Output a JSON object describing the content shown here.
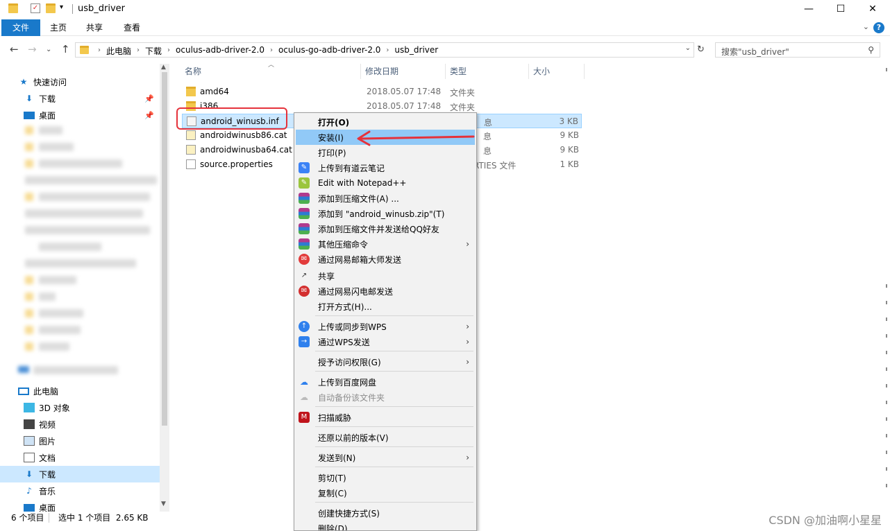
{
  "window": {
    "title": "usb_driver"
  },
  "ribbon": {
    "tabs": [
      "文件",
      "主页",
      "共享",
      "查看"
    ],
    "help": "?"
  },
  "address": {
    "crumbs": [
      "此电脑",
      "下载",
      "oculus-adb-driver-2.0",
      "oculus-go-adb-driver-2.0",
      "usb_driver"
    ],
    "search_placeholder": "搜索\"usb_driver\""
  },
  "sidebar": {
    "quick_access": "快速访问",
    "pinned": [
      "下载",
      "桌面"
    ],
    "this_pc": "此电脑",
    "pc_items": [
      "3D 对象",
      "视频",
      "图片",
      "文档",
      "下载",
      "音乐",
      "桌面"
    ]
  },
  "columns": {
    "name": "名称",
    "date": "修改日期",
    "type": "类型",
    "size": "大小"
  },
  "files": [
    {
      "name": "amd64",
      "date": "2018.05.07 17:48",
      "type": "文件夹",
      "size": "",
      "icon": "folder"
    },
    {
      "name": "i386",
      "date": "2018.05.07 17:48",
      "type": "文件夹",
      "size": "",
      "icon": "folder"
    },
    {
      "name": "android_winusb.inf",
      "date": "",
      "type": "息",
      "size": "3 KB",
      "icon": "inf-file"
    },
    {
      "name": "androidwinusb86.cat",
      "date": "",
      "type": "息",
      "size": "9 KB",
      "icon": "cat-file"
    },
    {
      "name": "androidwinusba64.cat",
      "date": "",
      "type": "息",
      "size": "9 KB",
      "icon": "cat-file"
    },
    {
      "name": "source.properties",
      "date": "",
      "type": "RTIES 文件",
      "size": "1 KB",
      "icon": "doc-file"
    }
  ],
  "context_menu": [
    {
      "label": "打开(O)",
      "bold": true
    },
    {
      "label": "安装(I)",
      "hover": true
    },
    {
      "label": "打印(P)"
    },
    {
      "label": "上传到有道云笔记",
      "icon": "youdao-icon"
    },
    {
      "label": "Edit with Notepad++",
      "icon": "notepad-icon"
    },
    {
      "label": "添加到压缩文件(A) ...",
      "icon": "winrar-icon"
    },
    {
      "label": "添加到 \"android_winusb.zip\"(T)",
      "icon": "winrar-icon"
    },
    {
      "label": "添加到压缩文件并发送给QQ好友",
      "icon": "winrar-icon"
    },
    {
      "label": "其他压缩命令",
      "icon": "winrar-icon",
      "submenu": true
    },
    {
      "label": "通过网易邮箱大师发送",
      "icon": "netease-mail-icon"
    },
    {
      "label": "共享",
      "icon": "share-icon"
    },
    {
      "label": "通过网易闪电邮发送",
      "icon": "netease-flash-icon"
    },
    {
      "label": "打开方式(H)..."
    },
    {
      "label": "上传或同步到WPS",
      "icon": "wps-cloud-icon",
      "submenu": true
    },
    {
      "label": "通过WPS发送",
      "icon": "wps-send-icon",
      "submenu": true
    },
    {
      "label": "授予访问权限(G)",
      "submenu": true
    },
    {
      "label": "上传到百度网盘",
      "icon": "baidu-icon"
    },
    {
      "label": "自动备份该文件夹",
      "icon": "baidu-icon",
      "disabled": true
    },
    {
      "label": "扫描威胁",
      "icon": "mcafee-icon"
    },
    {
      "label": "还原以前的版本(V)"
    },
    {
      "label": "发送到(N)",
      "submenu": true
    },
    {
      "label": "剪切(T)"
    },
    {
      "label": "复制(C)"
    },
    {
      "label": "创建快捷方式(S)"
    },
    {
      "label": "删除(D)"
    }
  ],
  "status": {
    "count": "6 个项目",
    "selection": "选中 1 个项目  2.65 KB"
  },
  "watermark": "CSDN @加油啊小星星",
  "colors": {
    "accent": "#1979ca",
    "selection": "#cce8ff",
    "menu_hover": "#91c9f7",
    "annotation": "#e5323b"
  }
}
